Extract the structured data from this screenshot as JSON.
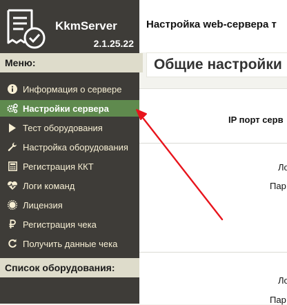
{
  "app": {
    "name": "KkmServer",
    "version": "2.1.25.22"
  },
  "sidebar": {
    "menu_label": "Меню:",
    "equipment_label": "Список оборудования:",
    "items": [
      {
        "label": "Информация о сервере",
        "icon": "info-icon"
      },
      {
        "label": "Настройки сервера",
        "icon": "gears-icon",
        "active": true
      },
      {
        "label": "Тест оборудования",
        "icon": "play-icon"
      },
      {
        "label": "Настройка оборудования",
        "icon": "wrench-icon"
      },
      {
        "label": "Регистрация ККТ",
        "icon": "calculator-icon"
      },
      {
        "label": "Логи команд",
        "icon": "heartbeat-icon"
      },
      {
        "label": "Лицензия",
        "icon": "certificate-icon"
      },
      {
        "label": "Регистрация чека",
        "icon": "ruble-icon"
      },
      {
        "label": "Получить данные чека",
        "icon": "refresh-icon"
      }
    ]
  },
  "header": {
    "title": "Настройка web-сервера т"
  },
  "main": {
    "section_title": "Общие настройки",
    "fields": {
      "ip_port": "IP порт серв",
      "login_1": "Ло",
      "password_1": "Пар",
      "login_2": "Ло",
      "password_2": "Пар"
    }
  },
  "colors": {
    "sidebar_bg": "#3e3c38",
    "active_item": "#5f8a4e",
    "arrow": "#e8141c"
  }
}
